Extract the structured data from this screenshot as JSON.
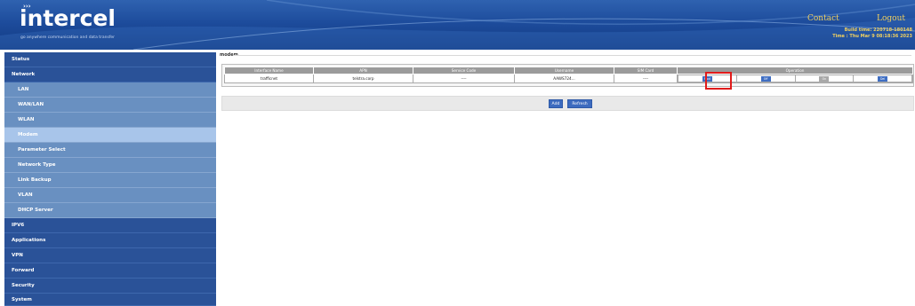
{
  "header": {
    "logo_dots": "›››",
    "logo": "intercel",
    "tagline": "go anywhere communication and data transfer",
    "contact": "Contact",
    "logout": "Logout",
    "build_time": "Build time: 220718-180148",
    "time": "Time : Thu Mar 9 08:18:36 2023"
  },
  "sidebar": {
    "items": [
      {
        "label": "Status",
        "level": "top"
      },
      {
        "label": "Network",
        "level": "top"
      },
      {
        "label": "LAN",
        "level": "sub"
      },
      {
        "label": "WAN/LAN",
        "level": "sub"
      },
      {
        "label": "WLAN",
        "level": "sub"
      },
      {
        "label": "Modem",
        "level": "sub",
        "active": true
      },
      {
        "label": "Parameter Select",
        "level": "sub"
      },
      {
        "label": "Network Type",
        "level": "sub"
      },
      {
        "label": "Link Backup",
        "level": "sub"
      },
      {
        "label": "VLAN",
        "level": "sub"
      },
      {
        "label": "DHCP Server",
        "level": "sub"
      },
      {
        "label": "IPV6",
        "level": "top"
      },
      {
        "label": "Applications",
        "level": "top"
      },
      {
        "label": "VPN",
        "level": "top"
      },
      {
        "label": "Forward",
        "level": "top"
      },
      {
        "label": "Security",
        "level": "top"
      },
      {
        "label": "System",
        "level": "top"
      }
    ]
  },
  "main": {
    "section_title": "modem",
    "table": {
      "headers": [
        "Interface Name",
        "APN",
        "Service Code",
        "Username",
        "SIM Card",
        "Operation"
      ],
      "rows": [
        {
          "interface_name": "trafficnet",
          "apn": "telstra.corp",
          "service_code": "----",
          "username": "AAWS724...",
          "sim_card": "----",
          "operations": [
            "Mod",
            "Off",
            "On",
            "Del"
          ]
        }
      ]
    },
    "buttons": {
      "add": "Add",
      "refresh": "Refresh"
    }
  },
  "colors": {
    "header_bg": "#1d4c9c",
    "sidebar_bg": "#2a559c",
    "sidebar_sub_bg": "#6990c1",
    "sidebar_active_bg": "#a8c5ea",
    "header_accent_text": "#f0d060",
    "button_bg": "#3d6bbf",
    "highlight": "#e01b1b"
  }
}
